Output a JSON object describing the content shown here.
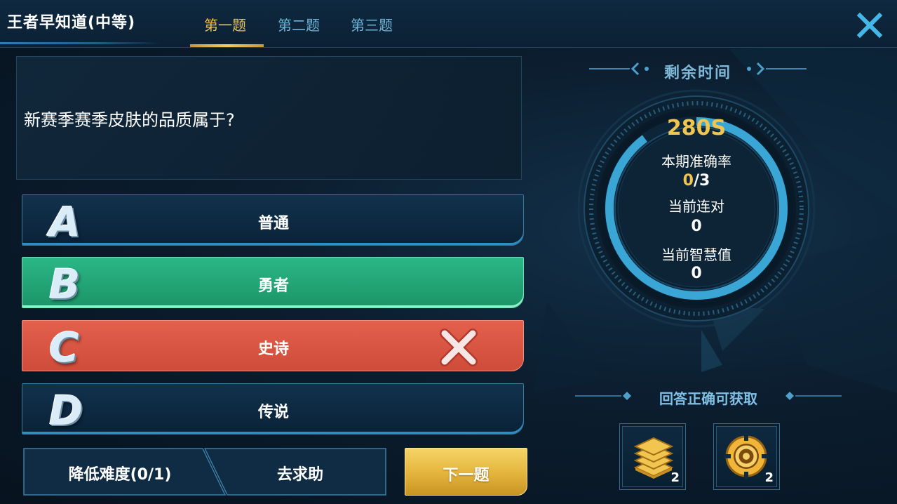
{
  "header": {
    "title": "王者早知道(中等)",
    "tabs": [
      {
        "label": "第一题",
        "active": true
      },
      {
        "label": "第二题",
        "active": false
      },
      {
        "label": "第三题",
        "active": false
      }
    ],
    "close_icon": "close-x-icon"
  },
  "question": {
    "text": "新赛季赛季皮肤的品质属于?"
  },
  "options": [
    {
      "letter": "A",
      "text": "普通",
      "state": "normal"
    },
    {
      "letter": "B",
      "text": "勇者",
      "state": "correct"
    },
    {
      "letter": "C",
      "text": "史诗",
      "state": "wrong"
    },
    {
      "letter": "D",
      "text": "传说",
      "state": "normal"
    }
  ],
  "actions": {
    "lower_difficulty": "降低难度(0/1)",
    "ask_help": "去求助",
    "next": "下一题"
  },
  "timer": {
    "title": "剩余时间",
    "time": "280S",
    "accuracy_label": "本期准确率",
    "accuracy_correct": "0",
    "accuracy_total": "/3",
    "streak_label": "当前连对",
    "streak_value": "0",
    "wisdom_label": "当前智慧值",
    "wisdom_value": "0"
  },
  "rewards": {
    "title": "回答正确可获取",
    "items": [
      {
        "icon": "coin-stack-icon",
        "count": "2"
      },
      {
        "icon": "gold-ring-token-icon",
        "count": "2"
      }
    ]
  },
  "colors": {
    "accent_gold": "#f0c550",
    "tab_inactive": "#6fb4d8",
    "correct_green": "#2bb786",
    "wrong_red": "#e2604c",
    "ring_blue": "#39a7d8"
  }
}
